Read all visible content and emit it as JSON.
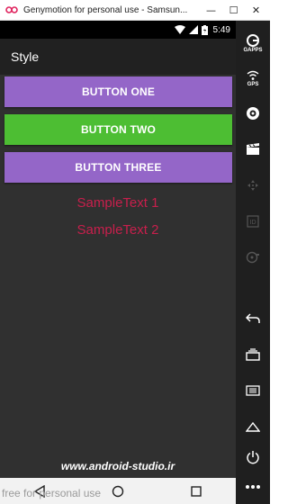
{
  "window": {
    "title": "Genymotion for personal use - Samsun...",
    "minimize_glyph": "—",
    "maximize_glyph": "☐",
    "close_glyph": "✕"
  },
  "statusbar": {
    "time": "5:49"
  },
  "actionbar": {
    "title": "Style"
  },
  "buttons": [
    {
      "label": "BUTTON ONE",
      "color": "#9466c8"
    },
    {
      "label": "BUTTON TWO",
      "color": "#4dbe33"
    },
    {
      "label": "BUTTON THREE",
      "color": "#9466c8"
    }
  ],
  "sample_texts": [
    {
      "text": "SampleText 1",
      "color": "#c81f4c"
    },
    {
      "text": "SampleText 2",
      "color": "#c81f4c"
    }
  ],
  "watermark": "www.android-studio.ir",
  "footer_note": "free for personal use",
  "sidebar": {
    "gapps_label": "GAPPS",
    "gps_label": "GPS",
    "id_label": "ID",
    "icons": [
      "gapps-icon",
      "gps-icon",
      "camera-icon",
      "video-icon",
      "dpad-icon",
      "id-icon",
      "disk-icon",
      "back-icon",
      "recents-icon",
      "menu-icon",
      "home-icon",
      "power-icon",
      "more-icon"
    ]
  },
  "navbar": {
    "icons": [
      "back-icon",
      "home-icon",
      "recents-icon"
    ]
  }
}
